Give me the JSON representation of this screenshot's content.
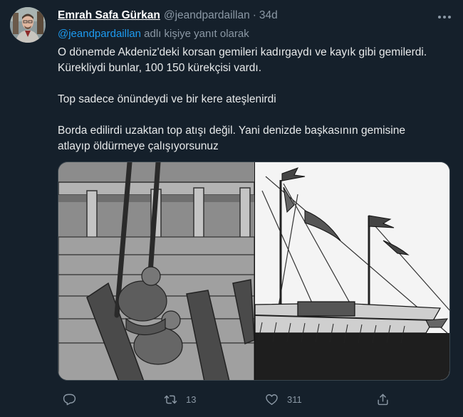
{
  "tweet": {
    "author": {
      "name": "Emrah Safa Gürkan",
      "handle": "@jeandpardaillan",
      "avatar_icon": "user-avatar"
    },
    "time": "34d",
    "separator": "·",
    "reply_to": {
      "mention": "@jeandpardaillan",
      "suffix": "adlı kişiye yanıt olarak"
    },
    "text": {
      "line1": "O dönemde Akdeniz'deki korsan gemileri kadırgaydı ve kayık gibi gemilerdi.",
      "line2": "Kürekliydi bunlar, 100 150 kürekçisi vardı.",
      "line3": "Top sadece önündeydi ve bir kere ateşlenirdi",
      "line4": "Borda edilirdi uzaktan top atışı değil. Yani denizde başkasının gemisine",
      "line5": "atlayıp öldürmeye çalışıyorsunuz"
    },
    "media": {
      "left_image": "galley-rowers-illustration",
      "right_image": "galley-ship-illustration"
    },
    "actions": {
      "reply_count": "",
      "retweet_count": "13",
      "like_count": "311"
    }
  },
  "colors": {
    "background": "#15202b",
    "accent": "#1d9bf0",
    "secondary_text": "#8b98a5",
    "primary_text": "#e7e9ea"
  }
}
